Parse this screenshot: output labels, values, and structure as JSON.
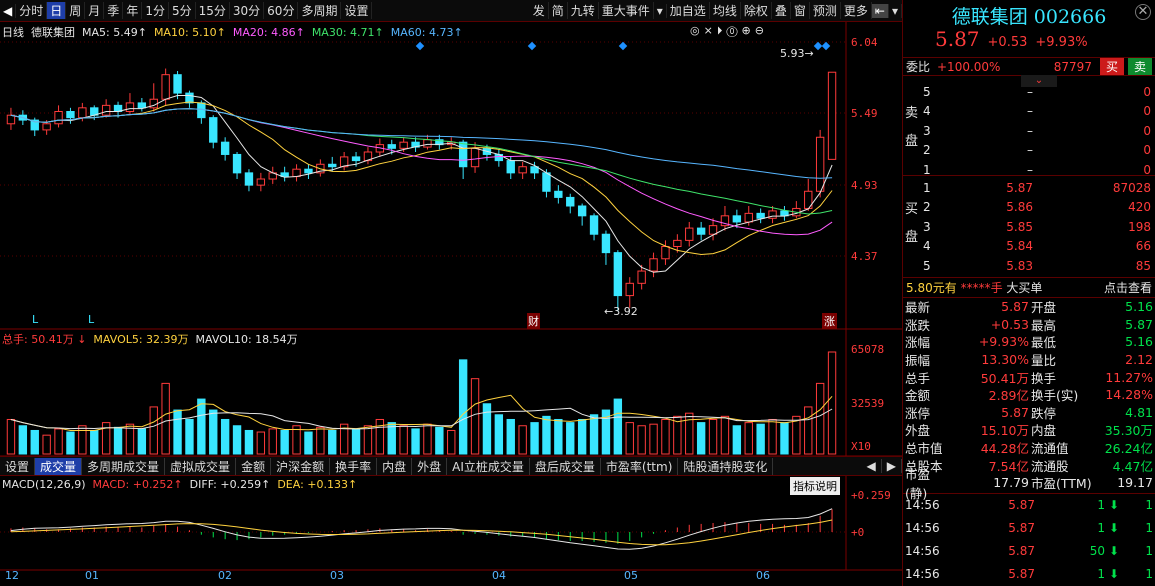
{
  "toolbar": {
    "left_tabs": [
      "分时",
      "日",
      "周",
      "月",
      "季",
      "年",
      "1分",
      "5分",
      "15分",
      "30分",
      "60分",
      "多周期",
      "设置"
    ],
    "active_tab": "日",
    "right_tabs": [
      "发",
      "简",
      "九转",
      "重大事件",
      "加自选",
      "均线",
      "除权",
      "叠",
      "窗",
      "预测",
      "更多"
    ],
    "nav_arrows": [
      "◀",
      "▶"
    ]
  },
  "stock": {
    "name": "德联集团",
    "code": "002666",
    "price": "5.87",
    "change": "+0.53",
    "change_pct": "+9.93%"
  },
  "kline_header": {
    "period": "日线",
    "name": "德联集团",
    "ma5": "MA5: 5.49↑",
    "ma10": "MA10: 5.10↑",
    "ma20": "MA20: 4.86↑",
    "ma30": "MA30: 4.71↑",
    "ma60": "MA60: 4.73↑"
  },
  "price_axis": [
    "6.04",
    "5.49",
    "4.93",
    "4.37"
  ],
  "annotations": {
    "high_label": "5.93",
    "low_label": "3.92",
    "finance_mark": "财",
    "limit_mark": "涨",
    "l_marks": [
      "L",
      "L"
    ]
  },
  "volume_header": {
    "total": "总手: 50.41万",
    "mavol5": "MAVOL5: 32.39万",
    "mavol10": "MAVOL10: 18.54万"
  },
  "volume_axis": [
    "65078",
    "32539",
    "X10"
  ],
  "bottom_tabs": [
    "设置",
    "成交量",
    "多周期成交量",
    "虚拟成交量",
    "金额",
    "沪深金额",
    "换手率",
    "内盘",
    "外盘",
    "AI立桩成交量",
    "盘后成交量",
    "市盈率(ttm)",
    "陆股通持股变化"
  ],
  "active_bottom_tab": "成交量",
  "macd_header": {
    "name": "MACD(12,26,9)",
    "macd": "MACD: +0.252↑",
    "diff": "DIFF: +0.259↑",
    "dea": "DEA: +0.133↑",
    "help": "指标说明"
  },
  "macd_axis": [
    "+0.259",
    "+0"
  ],
  "date_axis": [
    "12",
    "01",
    "02",
    "03",
    "04",
    "05",
    "06"
  ],
  "order_book": {
    "weibi_label": "委比",
    "weibi": "+100.00%",
    "weicha": "87797",
    "buy_btn": "买",
    "sell_btn": "卖",
    "sell_label": [
      "卖",
      "盘"
    ],
    "buy_label": [
      "买",
      "盘"
    ],
    "sells": [
      {
        "level": "5",
        "price": "–",
        "vol": "0"
      },
      {
        "level": "4",
        "price": "–",
        "vol": "0"
      },
      {
        "level": "3",
        "price": "–",
        "vol": "0"
      },
      {
        "level": "2",
        "price": "–",
        "vol": "0"
      },
      {
        "level": "1",
        "price": "–",
        "vol": "0"
      }
    ],
    "buys": [
      {
        "level": "1",
        "price": "5.87",
        "vol": "87028"
      },
      {
        "level": "2",
        "price": "5.86",
        "vol": "420"
      },
      {
        "level": "3",
        "price": "5.85",
        "vol": "198"
      },
      {
        "level": "4",
        "price": "5.84",
        "vol": "66"
      },
      {
        "level": "5",
        "price": "5.83",
        "vol": "85"
      }
    ]
  },
  "big_order": {
    "price": "5.80元有",
    "stars": "*****手",
    "label": "大买单",
    "link": "点击查看"
  },
  "quote": [
    [
      "最新",
      "5.87",
      "开盘",
      "5.16"
    ],
    [
      "涨跌",
      "+0.53",
      "最高",
      "5.87"
    ],
    [
      "涨幅",
      "+9.93%",
      "最低",
      "5.16"
    ],
    [
      "振幅",
      "13.30%",
      "量比",
      "2.12"
    ],
    [
      "总手",
      "50.41万",
      "换手",
      "11.27%"
    ],
    [
      "金额",
      "2.89亿",
      "换手(实)",
      "14.28%"
    ],
    [
      "涨停",
      "5.87",
      "跌停",
      "4.81"
    ],
    [
      "外盘",
      "15.10万",
      "内盘",
      "35.30万"
    ],
    [
      "总市值",
      "44.28亿",
      "流通值",
      "26.24亿"
    ],
    [
      "总股本",
      "7.54亿",
      "流通股",
      "4.47亿"
    ],
    [
      "市盈(静)",
      "17.79",
      "市盈(TTM)",
      "19.17"
    ]
  ],
  "ticks": [
    {
      "time": "14:56",
      "price": "5.87",
      "vol": "1",
      "n": "1"
    },
    {
      "time": "14:56",
      "price": "5.87",
      "vol": "1",
      "n": "1"
    },
    {
      "time": "14:56",
      "price": "5.87",
      "vol": "50",
      "n": "1"
    },
    {
      "time": "14:56",
      "price": "5.87",
      "vol": "1",
      "n": "1"
    }
  ],
  "colors": {
    "up": "#ff3b3b",
    "down": "#00e14b",
    "blue": "#1e3ea8",
    "ma5": "#e6e6e6",
    "ma10": "#ffd23f",
    "ma20": "#ff5cff",
    "ma30": "#3fe36a",
    "ma60": "#57b6ff"
  },
  "chart_data": {
    "type": "candlestick",
    "ylim": [
      3.9,
      6.1
    ],
    "candles": [
      [
        5.45,
        5.52,
        5.58,
        5.4
      ],
      [
        5.52,
        5.48,
        5.56,
        5.44
      ],
      [
        5.48,
        5.4,
        5.5,
        5.35
      ],
      [
        5.4,
        5.45,
        5.48,
        5.36
      ],
      [
        5.45,
        5.55,
        5.6,
        5.42
      ],
      [
        5.55,
        5.5,
        5.58,
        5.45
      ],
      [
        5.5,
        5.58,
        5.62,
        5.47
      ],
      [
        5.58,
        5.52,
        5.6,
        5.48
      ],
      [
        5.52,
        5.6,
        5.65,
        5.5
      ],
      [
        5.6,
        5.55,
        5.63,
        5.5
      ],
      [
        5.55,
        5.62,
        5.7,
        5.52
      ],
      [
        5.62,
        5.58,
        5.66,
        5.55
      ],
      [
        5.58,
        5.65,
        5.78,
        5.55
      ],
      [
        5.65,
        5.85,
        5.9,
        5.6
      ],
      [
        5.85,
        5.7,
        5.88,
        5.65
      ],
      [
        5.7,
        5.62,
        5.72,
        5.58
      ],
      [
        5.62,
        5.5,
        5.64,
        5.45
      ],
      [
        5.5,
        5.3,
        5.52,
        5.25
      ],
      [
        5.3,
        5.2,
        5.34,
        5.15
      ],
      [
        5.2,
        5.05,
        5.22,
        5.0
      ],
      [
        5.05,
        4.95,
        5.08,
        4.9
      ],
      [
        4.95,
        5.0,
        5.05,
        4.9
      ],
      [
        5.0,
        5.05,
        5.1,
        4.96
      ],
      [
        5.05,
        5.02,
        5.1,
        4.98
      ],
      [
        5.02,
        5.08,
        5.12,
        4.98
      ],
      [
        5.08,
        5.05,
        5.12,
        5.0
      ],
      [
        5.05,
        5.12,
        5.16,
        5.02
      ],
      [
        5.12,
        5.1,
        5.18,
        5.06
      ],
      [
        5.1,
        5.18,
        5.22,
        5.07
      ],
      [
        5.18,
        5.15,
        5.22,
        5.1
      ],
      [
        5.15,
        5.22,
        5.26,
        5.12
      ],
      [
        5.22,
        5.28,
        5.33,
        5.18
      ],
      [
        5.28,
        5.25,
        5.32,
        5.2
      ],
      [
        5.25,
        5.3,
        5.34,
        5.22
      ],
      [
        5.3,
        5.26,
        5.34,
        5.22
      ],
      [
        5.26,
        5.32,
        5.36,
        5.24
      ],
      [
        5.32,
        5.28,
        5.36,
        5.24
      ],
      [
        5.28,
        5.3,
        5.34,
        5.24
      ],
      [
        5.3,
        5.1,
        5.32,
        5.0
      ],
      [
        5.1,
        5.25,
        5.3,
        5.05
      ],
      [
        5.25,
        5.2,
        5.28,
        5.15
      ],
      [
        5.2,
        5.15,
        5.24,
        5.1
      ],
      [
        5.15,
        5.05,
        5.18,
        5.0
      ],
      [
        5.05,
        5.1,
        5.14,
        5.0
      ],
      [
        5.1,
        5.05,
        5.14,
        5.0
      ],
      [
        5.05,
        4.9,
        5.08,
        4.85
      ],
      [
        4.9,
        4.85,
        4.95,
        4.8
      ],
      [
        4.85,
        4.78,
        4.88,
        4.72
      ],
      [
        4.78,
        4.7,
        4.8,
        4.62
      ],
      [
        4.7,
        4.55,
        4.72,
        4.5
      ],
      [
        4.55,
        4.4,
        4.58,
        4.3
      ],
      [
        4.4,
        4.05,
        4.42,
        3.92
      ],
      [
        4.05,
        4.15,
        4.2,
        3.95
      ],
      [
        4.15,
        4.25,
        4.3,
        4.1
      ],
      [
        4.25,
        4.35,
        4.4,
        4.2
      ],
      [
        4.35,
        4.45,
        4.5,
        4.3
      ],
      [
        4.45,
        4.5,
        4.55,
        4.4
      ],
      [
        4.5,
        4.6,
        4.65,
        4.45
      ],
      [
        4.6,
        4.55,
        4.65,
        4.5
      ],
      [
        4.55,
        4.62,
        4.68,
        4.5
      ],
      [
        4.62,
        4.7,
        4.78,
        4.58
      ],
      [
        4.7,
        4.65,
        4.75,
        4.6
      ],
      [
        4.65,
        4.72,
        4.78,
        4.62
      ],
      [
        4.72,
        4.68,
        4.76,
        4.64
      ],
      [
        4.68,
        4.74,
        4.78,
        4.64
      ],
      [
        4.74,
        4.7,
        4.78,
        4.66
      ],
      [
        4.7,
        4.76,
        4.82,
        4.68
      ],
      [
        4.76,
        4.9,
        5.0,
        4.74
      ],
      [
        4.9,
        5.34,
        5.4,
        4.85
      ],
      [
        5.16,
        5.87,
        5.87,
        5.16
      ]
    ],
    "volume": [
      22,
      18,
      15,
      12,
      16,
      14,
      18,
      15,
      20,
      17,
      19,
      16,
      30,
      45,
      28,
      22,
      35,
      28,
      22,
      18,
      15,
      14,
      16,
      15,
      18,
      14,
      17,
      15,
      19,
      16,
      18,
      22,
      20,
      18,
      16,
      19,
      17,
      15,
      60,
      48,
      32,
      25,
      22,
      18,
      20,
      24,
      22,
      20,
      22,
      25,
      28,
      35,
      20,
      18,
      19,
      22,
      24,
      26,
      20,
      22,
      24,
      18,
      20,
      19,
      22,
      20,
      24,
      30,
      45,
      65
    ],
    "ma": {
      "ma5": {
        "name": "MA5",
        "color": "#e6e6e6"
      },
      "ma10": {
        "name": "MA10",
        "color": "#ffd23f"
      },
      "ma20": {
        "name": "MA20",
        "color": "#ff5cff"
      },
      "ma30": {
        "name": "MA30",
        "color": "#3fe36a"
      },
      "ma60": {
        "name": "MA60",
        "color": "#57b6ff"
      }
    },
    "macd": {
      "hist": [
        0.04,
        0.05,
        0.04,
        0.03,
        0.03,
        0.04,
        0.05,
        0.05,
        0.06,
        0.05,
        0.06,
        0.05,
        0.07,
        0.09,
        0.06,
        0.02,
        -0.03,
        -0.06,
        -0.08,
        -0.09,
        -0.08,
        -0.06,
        -0.04,
        -0.03,
        -0.02,
        -0.01,
        0.0,
        0.01,
        0.02,
        0.02,
        0.03,
        0.04,
        0.03,
        0.03,
        0.02,
        0.03,
        0.02,
        0.01,
        -0.03,
        -0.02,
        -0.03,
        -0.04,
        -0.05,
        -0.05,
        -0.06,
        -0.08,
        -0.09,
        -0.1,
        -0.1,
        -0.11,
        -0.12,
        -0.13,
        -0.1,
        -0.06,
        -0.02,
        0.02,
        0.05,
        0.08,
        0.09,
        0.1,
        0.11,
        0.1,
        0.1,
        0.09,
        0.09,
        0.08,
        0.08,
        0.1,
        0.18,
        0.252
      ],
      "diff_end": 0.259,
      "dea_end": 0.133
    }
  }
}
